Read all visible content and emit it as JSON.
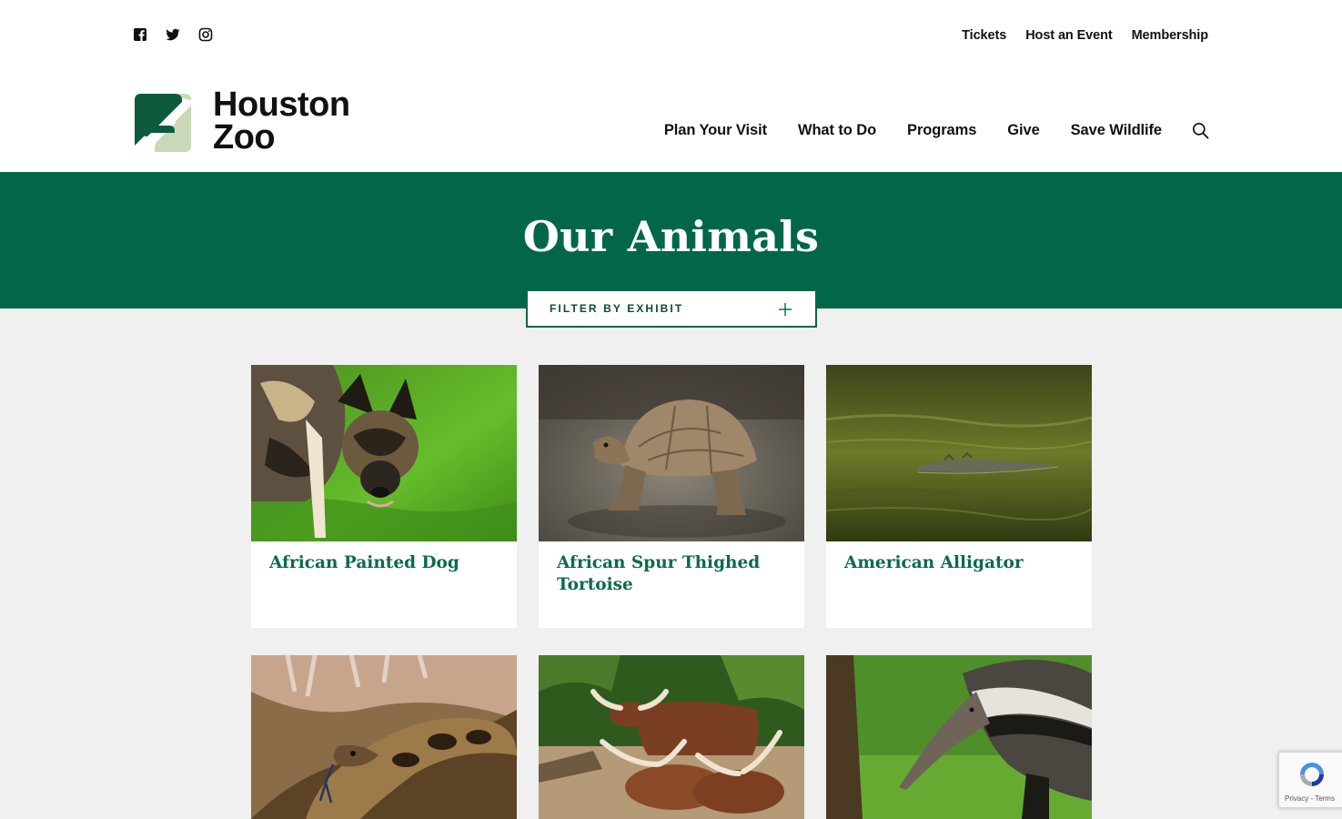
{
  "social": {
    "icons": [
      "facebook-icon",
      "twitter-icon",
      "instagram-icon"
    ]
  },
  "utility_nav": [
    "Tickets",
    "Host an Event",
    "Membership"
  ],
  "logo": {
    "line1": "Houston",
    "line2": "Zoo"
  },
  "main_nav": [
    "Plan Your Visit",
    "What to Do",
    "Programs",
    "Give",
    "Save Wildlife"
  ],
  "hero": {
    "title": "Our Animals"
  },
  "filter": {
    "label": "FILTER BY EXHIBIT"
  },
  "animals": [
    {
      "name": "African Painted Dog"
    },
    {
      "name": "African Spur Thighed Tortoise"
    },
    {
      "name": "American Alligator"
    },
    {
      "name": ""
    },
    {
      "name": ""
    },
    {
      "name": ""
    }
  ],
  "recaptcha": {
    "links": "Privacy - Terms"
  },
  "colors": {
    "brand_green": "#02674a",
    "link_green": "#0c6b4b",
    "logo_light": "#c9d8b6",
    "page_bg": "#f0f0f0"
  }
}
